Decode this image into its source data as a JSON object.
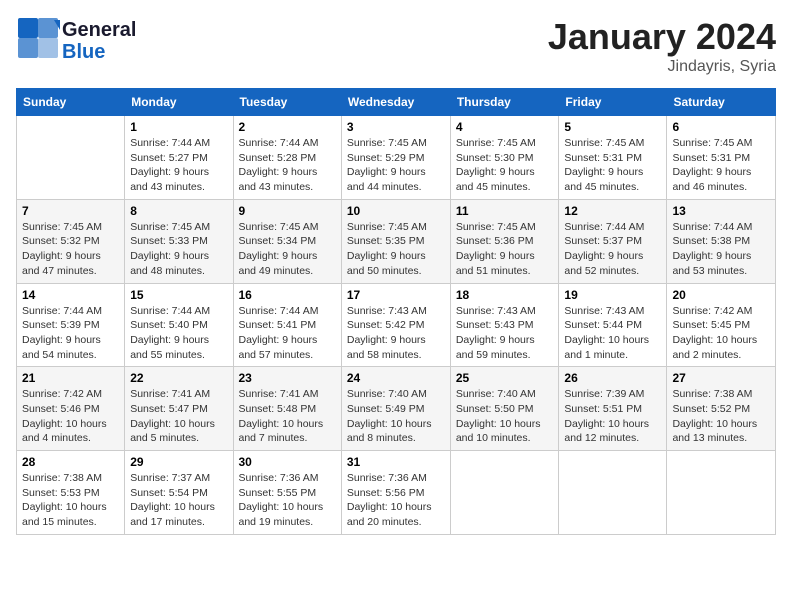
{
  "header": {
    "logo_line1": "General",
    "logo_line2": "Blue",
    "month_title": "January 2024",
    "location": "Jindayris, Syria"
  },
  "weekdays": [
    "Sunday",
    "Monday",
    "Tuesday",
    "Wednesday",
    "Thursday",
    "Friday",
    "Saturday"
  ],
  "weeks": [
    [
      {
        "day": "",
        "sunrise": "",
        "sunset": "",
        "daylight": ""
      },
      {
        "day": "1",
        "sunrise": "Sunrise: 7:44 AM",
        "sunset": "Sunset: 5:27 PM",
        "daylight": "Daylight: 9 hours and 43 minutes."
      },
      {
        "day": "2",
        "sunrise": "Sunrise: 7:44 AM",
        "sunset": "Sunset: 5:28 PM",
        "daylight": "Daylight: 9 hours and 43 minutes."
      },
      {
        "day": "3",
        "sunrise": "Sunrise: 7:45 AM",
        "sunset": "Sunset: 5:29 PM",
        "daylight": "Daylight: 9 hours and 44 minutes."
      },
      {
        "day": "4",
        "sunrise": "Sunrise: 7:45 AM",
        "sunset": "Sunset: 5:30 PM",
        "daylight": "Daylight: 9 hours and 45 minutes."
      },
      {
        "day": "5",
        "sunrise": "Sunrise: 7:45 AM",
        "sunset": "Sunset: 5:31 PM",
        "daylight": "Daylight: 9 hours and 45 minutes."
      },
      {
        "day": "6",
        "sunrise": "Sunrise: 7:45 AM",
        "sunset": "Sunset: 5:31 PM",
        "daylight": "Daylight: 9 hours and 46 minutes."
      }
    ],
    [
      {
        "day": "7",
        "sunrise": "Sunrise: 7:45 AM",
        "sunset": "Sunset: 5:32 PM",
        "daylight": "Daylight: 9 hours and 47 minutes."
      },
      {
        "day": "8",
        "sunrise": "Sunrise: 7:45 AM",
        "sunset": "Sunset: 5:33 PM",
        "daylight": "Daylight: 9 hours and 48 minutes."
      },
      {
        "day": "9",
        "sunrise": "Sunrise: 7:45 AM",
        "sunset": "Sunset: 5:34 PM",
        "daylight": "Daylight: 9 hours and 49 minutes."
      },
      {
        "day": "10",
        "sunrise": "Sunrise: 7:45 AM",
        "sunset": "Sunset: 5:35 PM",
        "daylight": "Daylight: 9 hours and 50 minutes."
      },
      {
        "day": "11",
        "sunrise": "Sunrise: 7:45 AM",
        "sunset": "Sunset: 5:36 PM",
        "daylight": "Daylight: 9 hours and 51 minutes."
      },
      {
        "day": "12",
        "sunrise": "Sunrise: 7:44 AM",
        "sunset": "Sunset: 5:37 PM",
        "daylight": "Daylight: 9 hours and 52 minutes."
      },
      {
        "day": "13",
        "sunrise": "Sunrise: 7:44 AM",
        "sunset": "Sunset: 5:38 PM",
        "daylight": "Daylight: 9 hours and 53 minutes."
      }
    ],
    [
      {
        "day": "14",
        "sunrise": "Sunrise: 7:44 AM",
        "sunset": "Sunset: 5:39 PM",
        "daylight": "Daylight: 9 hours and 54 minutes."
      },
      {
        "day": "15",
        "sunrise": "Sunrise: 7:44 AM",
        "sunset": "Sunset: 5:40 PM",
        "daylight": "Daylight: 9 hours and 55 minutes."
      },
      {
        "day": "16",
        "sunrise": "Sunrise: 7:44 AM",
        "sunset": "Sunset: 5:41 PM",
        "daylight": "Daylight: 9 hours and 57 minutes."
      },
      {
        "day": "17",
        "sunrise": "Sunrise: 7:43 AM",
        "sunset": "Sunset: 5:42 PM",
        "daylight": "Daylight: 9 hours and 58 minutes."
      },
      {
        "day": "18",
        "sunrise": "Sunrise: 7:43 AM",
        "sunset": "Sunset: 5:43 PM",
        "daylight": "Daylight: 9 hours and 59 minutes."
      },
      {
        "day": "19",
        "sunrise": "Sunrise: 7:43 AM",
        "sunset": "Sunset: 5:44 PM",
        "daylight": "Daylight: 10 hours and 1 minute."
      },
      {
        "day": "20",
        "sunrise": "Sunrise: 7:42 AM",
        "sunset": "Sunset: 5:45 PM",
        "daylight": "Daylight: 10 hours and 2 minutes."
      }
    ],
    [
      {
        "day": "21",
        "sunrise": "Sunrise: 7:42 AM",
        "sunset": "Sunset: 5:46 PM",
        "daylight": "Daylight: 10 hours and 4 minutes."
      },
      {
        "day": "22",
        "sunrise": "Sunrise: 7:41 AM",
        "sunset": "Sunset: 5:47 PM",
        "daylight": "Daylight: 10 hours and 5 minutes."
      },
      {
        "day": "23",
        "sunrise": "Sunrise: 7:41 AM",
        "sunset": "Sunset: 5:48 PM",
        "daylight": "Daylight: 10 hours and 7 minutes."
      },
      {
        "day": "24",
        "sunrise": "Sunrise: 7:40 AM",
        "sunset": "Sunset: 5:49 PM",
        "daylight": "Daylight: 10 hours and 8 minutes."
      },
      {
        "day": "25",
        "sunrise": "Sunrise: 7:40 AM",
        "sunset": "Sunset: 5:50 PM",
        "daylight": "Daylight: 10 hours and 10 minutes."
      },
      {
        "day": "26",
        "sunrise": "Sunrise: 7:39 AM",
        "sunset": "Sunset: 5:51 PM",
        "daylight": "Daylight: 10 hours and 12 minutes."
      },
      {
        "day": "27",
        "sunrise": "Sunrise: 7:38 AM",
        "sunset": "Sunset: 5:52 PM",
        "daylight": "Daylight: 10 hours and 13 minutes."
      }
    ],
    [
      {
        "day": "28",
        "sunrise": "Sunrise: 7:38 AM",
        "sunset": "Sunset: 5:53 PM",
        "daylight": "Daylight: 10 hours and 15 minutes."
      },
      {
        "day": "29",
        "sunrise": "Sunrise: 7:37 AM",
        "sunset": "Sunset: 5:54 PM",
        "daylight": "Daylight: 10 hours and 17 minutes."
      },
      {
        "day": "30",
        "sunrise": "Sunrise: 7:36 AM",
        "sunset": "Sunset: 5:55 PM",
        "daylight": "Daylight: 10 hours and 19 minutes."
      },
      {
        "day": "31",
        "sunrise": "Sunrise: 7:36 AM",
        "sunset": "Sunset: 5:56 PM",
        "daylight": "Daylight: 10 hours and 20 minutes."
      },
      {
        "day": "",
        "sunrise": "",
        "sunset": "",
        "daylight": ""
      },
      {
        "day": "",
        "sunrise": "",
        "sunset": "",
        "daylight": ""
      },
      {
        "day": "",
        "sunrise": "",
        "sunset": "",
        "daylight": ""
      }
    ]
  ]
}
